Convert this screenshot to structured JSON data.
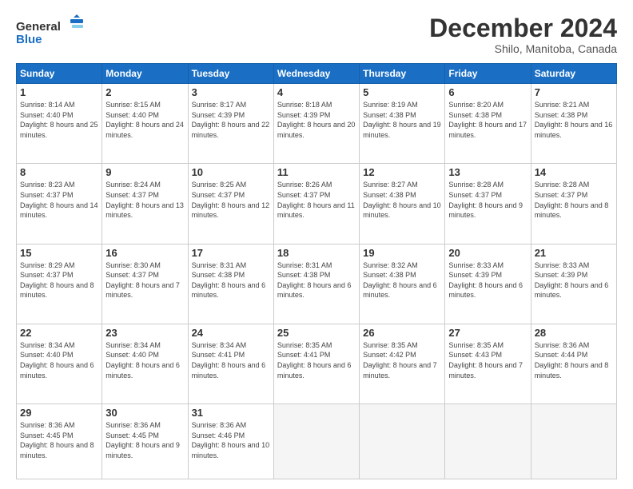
{
  "header": {
    "logo_line1": "General",
    "logo_line2": "Blue",
    "month": "December 2024",
    "location": "Shilo, Manitoba, Canada"
  },
  "weekdays": [
    "Sunday",
    "Monday",
    "Tuesday",
    "Wednesday",
    "Thursday",
    "Friday",
    "Saturday"
  ],
  "weeks": [
    [
      {
        "day": "1",
        "sunrise": "Sunrise: 8:14 AM",
        "sunset": "Sunset: 4:40 PM",
        "daylight": "Daylight: 8 hours and 25 minutes."
      },
      {
        "day": "2",
        "sunrise": "Sunrise: 8:15 AM",
        "sunset": "Sunset: 4:40 PM",
        "daylight": "Daylight: 8 hours and 24 minutes."
      },
      {
        "day": "3",
        "sunrise": "Sunrise: 8:17 AM",
        "sunset": "Sunset: 4:39 PM",
        "daylight": "Daylight: 8 hours and 22 minutes."
      },
      {
        "day": "4",
        "sunrise": "Sunrise: 8:18 AM",
        "sunset": "Sunset: 4:39 PM",
        "daylight": "Daylight: 8 hours and 20 minutes."
      },
      {
        "day": "5",
        "sunrise": "Sunrise: 8:19 AM",
        "sunset": "Sunset: 4:38 PM",
        "daylight": "Daylight: 8 hours and 19 minutes."
      },
      {
        "day": "6",
        "sunrise": "Sunrise: 8:20 AM",
        "sunset": "Sunset: 4:38 PM",
        "daylight": "Daylight: 8 hours and 17 minutes."
      },
      {
        "day": "7",
        "sunrise": "Sunrise: 8:21 AM",
        "sunset": "Sunset: 4:38 PM",
        "daylight": "Daylight: 8 hours and 16 minutes."
      }
    ],
    [
      {
        "day": "8",
        "sunrise": "Sunrise: 8:23 AM",
        "sunset": "Sunset: 4:37 PM",
        "daylight": "Daylight: 8 hours and 14 minutes."
      },
      {
        "day": "9",
        "sunrise": "Sunrise: 8:24 AM",
        "sunset": "Sunset: 4:37 PM",
        "daylight": "Daylight: 8 hours and 13 minutes."
      },
      {
        "day": "10",
        "sunrise": "Sunrise: 8:25 AM",
        "sunset": "Sunset: 4:37 PM",
        "daylight": "Daylight: 8 hours and 12 minutes."
      },
      {
        "day": "11",
        "sunrise": "Sunrise: 8:26 AM",
        "sunset": "Sunset: 4:37 PM",
        "daylight": "Daylight: 8 hours and 11 minutes."
      },
      {
        "day": "12",
        "sunrise": "Sunrise: 8:27 AM",
        "sunset": "Sunset: 4:38 PM",
        "daylight": "Daylight: 8 hours and 10 minutes."
      },
      {
        "day": "13",
        "sunrise": "Sunrise: 8:28 AM",
        "sunset": "Sunset: 4:37 PM",
        "daylight": "Daylight: 8 hours and 9 minutes."
      },
      {
        "day": "14",
        "sunrise": "Sunrise: 8:28 AM",
        "sunset": "Sunset: 4:37 PM",
        "daylight": "Daylight: 8 hours and 8 minutes."
      }
    ],
    [
      {
        "day": "15",
        "sunrise": "Sunrise: 8:29 AM",
        "sunset": "Sunset: 4:37 PM",
        "daylight": "Daylight: 8 hours and 8 minutes."
      },
      {
        "day": "16",
        "sunrise": "Sunrise: 8:30 AM",
        "sunset": "Sunset: 4:37 PM",
        "daylight": "Daylight: 8 hours and 7 minutes."
      },
      {
        "day": "17",
        "sunrise": "Sunrise: 8:31 AM",
        "sunset": "Sunset: 4:38 PM",
        "daylight": "Daylight: 8 hours and 6 minutes."
      },
      {
        "day": "18",
        "sunrise": "Sunrise: 8:31 AM",
        "sunset": "Sunset: 4:38 PM",
        "daylight": "Daylight: 8 hours and 6 minutes."
      },
      {
        "day": "19",
        "sunrise": "Sunrise: 8:32 AM",
        "sunset": "Sunset: 4:38 PM",
        "daylight": "Daylight: 8 hours and 6 minutes."
      },
      {
        "day": "20",
        "sunrise": "Sunrise: 8:33 AM",
        "sunset": "Sunset: 4:39 PM",
        "daylight": "Daylight: 8 hours and 6 minutes."
      },
      {
        "day": "21",
        "sunrise": "Sunrise: 8:33 AM",
        "sunset": "Sunset: 4:39 PM",
        "daylight": "Daylight: 8 hours and 6 minutes."
      }
    ],
    [
      {
        "day": "22",
        "sunrise": "Sunrise: 8:34 AM",
        "sunset": "Sunset: 4:40 PM",
        "daylight": "Daylight: 8 hours and 6 minutes."
      },
      {
        "day": "23",
        "sunrise": "Sunrise: 8:34 AM",
        "sunset": "Sunset: 4:40 PM",
        "daylight": "Daylight: 8 hours and 6 minutes."
      },
      {
        "day": "24",
        "sunrise": "Sunrise: 8:34 AM",
        "sunset": "Sunset: 4:41 PM",
        "daylight": "Daylight: 8 hours and 6 minutes."
      },
      {
        "day": "25",
        "sunrise": "Sunrise: 8:35 AM",
        "sunset": "Sunset: 4:41 PM",
        "daylight": "Daylight: 8 hours and 6 minutes."
      },
      {
        "day": "26",
        "sunrise": "Sunrise: 8:35 AM",
        "sunset": "Sunset: 4:42 PM",
        "daylight": "Daylight: 8 hours and 7 minutes."
      },
      {
        "day": "27",
        "sunrise": "Sunrise: 8:35 AM",
        "sunset": "Sunset: 4:43 PM",
        "daylight": "Daylight: 8 hours and 7 minutes."
      },
      {
        "day": "28",
        "sunrise": "Sunrise: 8:36 AM",
        "sunset": "Sunset: 4:44 PM",
        "daylight": "Daylight: 8 hours and 8 minutes."
      }
    ],
    [
      {
        "day": "29",
        "sunrise": "Sunrise: 8:36 AM",
        "sunset": "Sunset: 4:45 PM",
        "daylight": "Daylight: 8 hours and 8 minutes."
      },
      {
        "day": "30",
        "sunrise": "Sunrise: 8:36 AM",
        "sunset": "Sunset: 4:45 PM",
        "daylight": "Daylight: 8 hours and 9 minutes."
      },
      {
        "day": "31",
        "sunrise": "Sunrise: 8:36 AM",
        "sunset": "Sunset: 4:46 PM",
        "daylight": "Daylight: 8 hours and 10 minutes."
      },
      null,
      null,
      null,
      null
    ]
  ]
}
